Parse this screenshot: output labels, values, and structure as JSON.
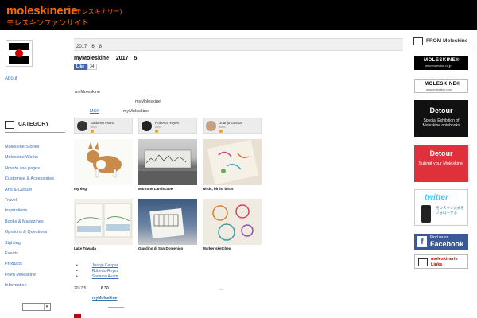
{
  "header": {
    "title": "moleskinerie",
    "title_kana": "(モレスキナリー)",
    "subtitle": "モレスキンファンサイト"
  },
  "sidebar_left": {
    "about": "About",
    "category_heading": "CATEGORY",
    "categories": [
      "Moleskine Stories",
      "Moleskine Works",
      "How to use pages",
      "Customise & Accessories",
      "Arts & Culture",
      "Travel",
      "Inspirations",
      "Books & Magazines",
      "Opinions & Questions",
      "Sighting",
      "Events",
      "Products",
      "From Moleskine",
      "Information"
    ]
  },
  "main": {
    "date": "2017　6　8",
    "post_title": "myMoleskine　 2017　5",
    "like_label": "Like",
    "like_count": "34",
    "text_1": "myMoleskine",
    "text_2": "myMoleskine",
    "text_3_link": "MSK",
    "text_3_rest": "myMoleskine",
    "profiles": [
      {
        "name": "Sadamu Asami",
        "role": "artist"
      },
      {
        "name": "Roberto Reyes",
        "role": "artist"
      },
      {
        "name": "Juanjo Gaspar",
        "role": "artist"
      }
    ],
    "thumbs": [
      {
        "caption": "my dog"
      },
      {
        "caption": "Mantone Landscape"
      },
      {
        "caption": "Birds, birds, birds"
      },
      {
        "caption": "Lake Towada"
      },
      {
        "caption": "Giardino di San Domenico"
      },
      {
        "caption": "Marker sketches"
      }
    ],
    "writers": [
      "Juanjo Gaspar",
      "Roberto Reyes",
      "Sadamu Asami"
    ],
    "bottom_date_1": "2017 5",
    "bottom_date_2": "6 30",
    "ellipsis": "...",
    "bottom_link": "myMoleskine"
  },
  "sidebar_right": {
    "heading": "FROM Moleskine",
    "banners": [
      {
        "main": "MOLESKINE®",
        "sub": "www.moleskine.co.jp"
      },
      {
        "main": "MOLESKINE®",
        "sub": "www.moleskine.com"
      },
      {
        "main": "Detour",
        "sub": "Special Exhibition of Moleskine notebooks"
      },
      {
        "main": "Detour",
        "sub": "Submit your Moleskine!"
      },
      {
        "main": "twitter",
        "sub": "モレスキン公式をフォローする"
      },
      {
        "main": "Find us on",
        "sub": "Facebook",
        "icon": "f"
      },
      {
        "main": "moleskinerie",
        "sub": "Links"
      }
    ]
  },
  "colors": {
    "brand_orange": "#ff6a00",
    "link_blue": "#3a6fb0",
    "facebook_blue": "#3b5998",
    "detour_red": "#e0303c"
  }
}
